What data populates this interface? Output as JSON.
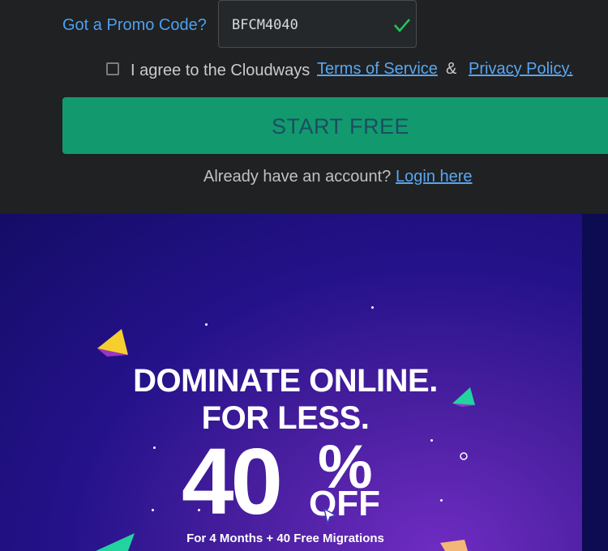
{
  "form": {
    "promo_label": "Got a Promo Code?",
    "promo_value": "BFCM4040",
    "agree_text": "I agree to the Cloudways",
    "terms_link": "Terms of Service",
    "amp": "&",
    "privacy_link": "Privacy Policy.",
    "start_button": "START FREE",
    "already_text": "Already have an account?",
    "login_link": "Login here"
  },
  "banner": {
    "headline_line1": "DOMINATE ONLINE.",
    "headline_line2": "FOR LESS.",
    "discount_number": "40",
    "discount_percent": "%",
    "discount_off": "OFF",
    "subline": "For 4 Months + 40 Free Migrations"
  },
  "colors": {
    "accent_green": "#129a6e",
    "link_blue": "#5aa6f0",
    "banner_purple": "#4a1fa0"
  }
}
